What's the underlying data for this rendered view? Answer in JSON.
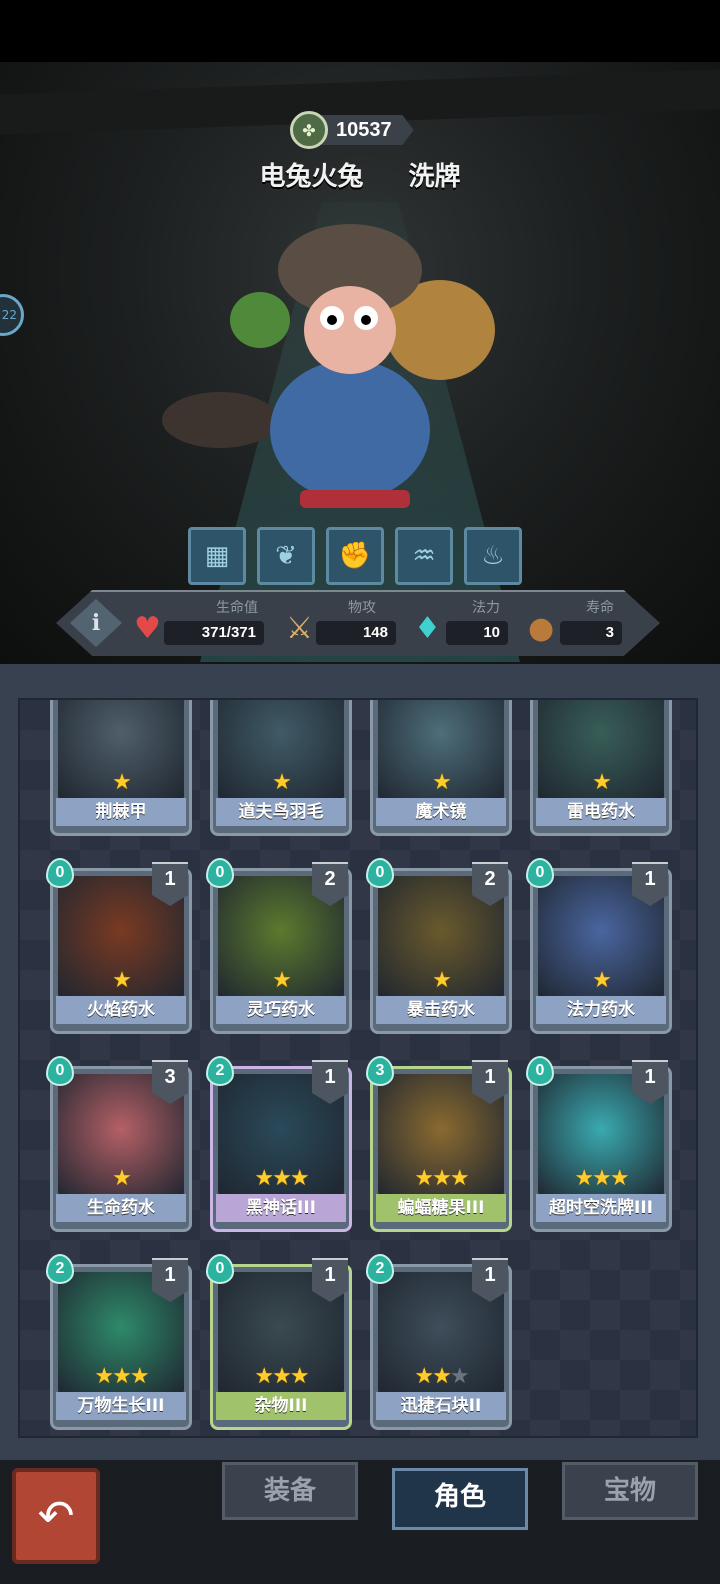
{
  "header": {
    "currency_amount": "10537",
    "currency_icon": "clover-coin-icon",
    "character_name": "电兔火兔",
    "shuffle_label": "洗牌",
    "side_badge": "22"
  },
  "skills": [
    {
      "icon": "box-skill-icon",
      "glyph": "▦"
    },
    {
      "icon": "leaf-skill-icon",
      "glyph": "❦"
    },
    {
      "icon": "fist-skill-icon",
      "glyph": "✊"
    },
    {
      "icon": "fish-skill-icon",
      "glyph": "♒"
    },
    {
      "icon": "bowl-skill-icon",
      "glyph": "♨"
    }
  ],
  "stats": {
    "info_label": "i",
    "hp": {
      "label": "生命值",
      "value": "371/371",
      "icon": "heart-icon"
    },
    "attack": {
      "label": "物攻",
      "value": "148",
      "icon": "sword-icon"
    },
    "mana": {
      "label": "法力",
      "value": "10",
      "icon": "mana-flame-icon"
    },
    "lifespan": {
      "label": "寿命",
      "value": "3",
      "icon": "acorn-icon"
    }
  },
  "cards": [
    {
      "name": "荆棘甲",
      "stars": 1,
      "max_stars": 1,
      "cost": "",
      "count": "",
      "art": "#4f5f6a",
      "tier": "normal"
    },
    {
      "name": "道夫鸟羽毛",
      "stars": 1,
      "max_stars": 1,
      "cost": "",
      "count": "",
      "art": "#3f5b66",
      "tier": "normal"
    },
    {
      "name": "魔术镜",
      "stars": 1,
      "max_stars": 1,
      "cost": "",
      "count": "",
      "art": "#4d6e7a",
      "tier": "normal"
    },
    {
      "name": "雷电药水",
      "stars": 1,
      "max_stars": 1,
      "cost": "",
      "count": "",
      "art": "#385e58",
      "tier": "normal"
    },
    {
      "name": "火焰药水",
      "stars": 1,
      "max_stars": 1,
      "cost": "0",
      "count": "1",
      "art": "#7a3a22",
      "tier": "normal"
    },
    {
      "name": "灵巧药水",
      "stars": 1,
      "max_stars": 1,
      "cost": "0",
      "count": "2",
      "art": "#5c7a2e",
      "tier": "normal"
    },
    {
      "name": "暴击药水",
      "stars": 1,
      "max_stars": 1,
      "cost": "0",
      "count": "2",
      "art": "#6a5a2c",
      "tier": "normal"
    },
    {
      "name": "法力药水",
      "stars": 1,
      "max_stars": 1,
      "cost": "0",
      "count": "1",
      "art": "#4a66a0",
      "tier": "normal"
    },
    {
      "name": "生命药水",
      "stars": 1,
      "max_stars": 1,
      "cost": "0",
      "count": "3",
      "art": "#b56066",
      "tier": "normal"
    },
    {
      "name": "黑神话III",
      "stars": 3,
      "max_stars": 3,
      "cost": "2",
      "count": "1",
      "art": "#2a4a5a",
      "tier": "rare"
    },
    {
      "name": "蝙蝠糖果III",
      "stars": 3,
      "max_stars": 3,
      "cost": "3",
      "count": "1",
      "art": "#8a6a30",
      "tier": "green"
    },
    {
      "name": "超时空洗牌III",
      "stars": 3,
      "max_stars": 3,
      "cost": "0",
      "count": "1",
      "art": "#3aaab0",
      "tier": "normal"
    },
    {
      "name": "万物生长III",
      "stars": 3,
      "max_stars": 3,
      "cost": "2",
      "count": "1",
      "art": "#2e8a6a",
      "tier": "normal"
    },
    {
      "name": "杂物III",
      "stars": 3,
      "max_stars": 3,
      "cost": "0",
      "count": "1",
      "art": "#3a4a50",
      "tier": "green"
    },
    {
      "name": "迅捷石块II",
      "stars": 2,
      "max_stars": 3,
      "cost": "2",
      "count": "1",
      "art": "#3e4e5a",
      "tier": "normal"
    }
  ],
  "tabs": {
    "back_icon": "back-arrow-icon",
    "equipment": "装备",
    "character": "角色",
    "treasure": "宝物"
  }
}
